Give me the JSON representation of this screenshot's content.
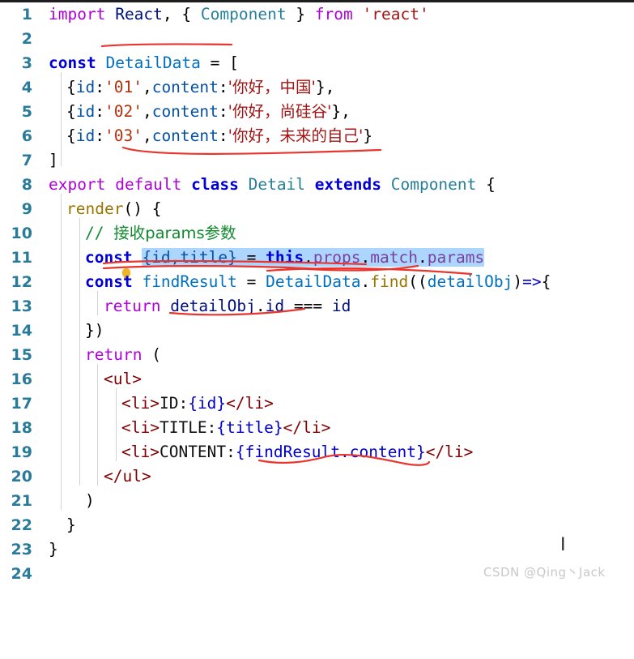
{
  "editor": {
    "language": "javascript-react",
    "theme_background": "#ffffff",
    "line_number_color": "#2a7b9b",
    "selection_color": "#add6ff",
    "annotation_color": "#e8352e",
    "total_lines": 24,
    "first_line": 1,
    "last_line": 24
  },
  "gutter": {
    "line_numbers": [
      "1",
      "2",
      "3",
      "4",
      "5",
      "6",
      "7",
      "8",
      "9",
      "10",
      "11",
      "12",
      "13",
      "14",
      "15",
      "16",
      "17",
      "18",
      "19",
      "20",
      "21",
      "22",
      "23",
      "24"
    ],
    "lightbulb_line": "11",
    "lightbulb_icon": "lightbulb-icon"
  },
  "code": {
    "lines": [
      {
        "n": "1",
        "text": "import React, { Component } from 'react'"
      },
      {
        "n": "2",
        "text": ""
      },
      {
        "n": "3",
        "text": "const DetailData = ["
      },
      {
        "n": "4",
        "text": "  {id:'01',content:'你好，中国'},"
      },
      {
        "n": "5",
        "text": "  {id:'02',content:'你好，尚硅谷'},"
      },
      {
        "n": "6",
        "text": "  {id:'03',content:'你好，未来的自己'}"
      },
      {
        "n": "7",
        "text": "]"
      },
      {
        "n": "8",
        "text": "export default class Detail extends Component {"
      },
      {
        "n": "9",
        "text": "  render() {"
      },
      {
        "n": "10",
        "text": "    // 接收params参数"
      },
      {
        "n": "11",
        "text": "    const {id,title} = this.props.match.params"
      },
      {
        "n": "12",
        "text": "    const findResult = DetailData.find((detailObj)=>{"
      },
      {
        "n": "13",
        "text": "      return detailObj.id === id"
      },
      {
        "n": "14",
        "text": "    })"
      },
      {
        "n": "15",
        "text": "    return ("
      },
      {
        "n": "16",
        "text": "      <ul>"
      },
      {
        "n": "17",
        "text": "        <li>ID:{id}</li>"
      },
      {
        "n": "18",
        "text": "        <li>TITLE:{title}</li>"
      },
      {
        "n": "19",
        "text": "        <li>CONTENT:{findResult.content}</li>"
      },
      {
        "n": "20",
        "text": "      </ul>"
      },
      {
        "n": "21",
        "text": "    )"
      },
      {
        "n": "22",
        "text": "  }"
      },
      {
        "n": "23",
        "text": "}"
      },
      {
        "n": "24",
        "text": ""
      }
    ]
  },
  "tokens": {
    "l1": {
      "import": "import",
      "react_ident": "React",
      "comma": ",",
      "brace_open": "{",
      "component": "Component",
      "brace_close": "}",
      "from": "from",
      "module": "'react'"
    },
    "l3": {
      "const": "const",
      "name": "DetailData",
      "eq": "=",
      "bracket": "["
    },
    "l4": {
      "id_key": "id",
      "id_val": "'01'",
      "content_key": "content",
      "content_val": "'你好，中国'"
    },
    "l5": {
      "id_key": "id",
      "id_val": "'02'",
      "content_key": "content",
      "content_val": "'你好，尚硅谷'"
    },
    "l6": {
      "id_key": "id",
      "id_val": "'03'",
      "content_key": "content",
      "content_val": "'你好，未来的自己'"
    },
    "l7": {
      "bracket": "]"
    },
    "l8": {
      "export": "export",
      "default": "default",
      "class": "class",
      "name": "Detail",
      "extends": "extends",
      "component": "Component",
      "brace": "{"
    },
    "l9": {
      "render": "render",
      "parens": "()",
      "brace": "{"
    },
    "l10": {
      "slashes": "//",
      "comment": "接收params参数"
    },
    "l11": {
      "const": "const",
      "destructure": "{id,title}",
      "eq": "=",
      "this": "this",
      "props": "props",
      "match": "match",
      "params": "params",
      "selected": true
    },
    "l12": {
      "const": "const",
      "name": "findResult",
      "eq": "=",
      "obj": "DetailData",
      "method": "find",
      "arg": "detailObj",
      "arrow": "=>"
    },
    "l13": {
      "return": "return",
      "obj": "detailObj",
      "prop": "id",
      "op": "===",
      "id": "id"
    },
    "l15": {
      "return": "return",
      "paren": "("
    },
    "l16": {
      "tag": "<ul>"
    },
    "l17": {
      "open": "<li>",
      "label": "ID:",
      "expr": "{id}",
      "close": "</li>"
    },
    "l18": {
      "open": "<li>",
      "label": "TITLE:",
      "expr": "{title}",
      "close": "</li>"
    },
    "l19": {
      "open": "<li>",
      "label": "CONTENT:",
      "expr": "{findResult.content}",
      "close": "</li>"
    },
    "l20": {
      "tag": "</ul>"
    }
  },
  "annotations": {
    "color": "#e8352e",
    "marks": [
      {
        "name": "underline-detaildata-line3",
        "target": "DetailData"
      },
      {
        "name": "underline-ids-line6",
        "target": "'03',content"
      },
      {
        "name": "underline-destructure-line11",
        "target": "{id,title}"
      },
      {
        "name": "underline-params-line11",
        "target": "match.params"
      },
      {
        "name": "underline-findresult-line12",
        "target": "findResult = DetailData"
      },
      {
        "name": "underline-find-line12",
        "target": "DetailData.find"
      },
      {
        "name": "underline-detailobj-line13",
        "target": "detailObj.id"
      },
      {
        "name": "underline-findresultcontent-line19",
        "target": "{findResult.content}"
      }
    ]
  },
  "watermark": {
    "text": "CSDN @Qing丶Jack",
    "cursor_icon": "text-ibeam-cursor"
  }
}
